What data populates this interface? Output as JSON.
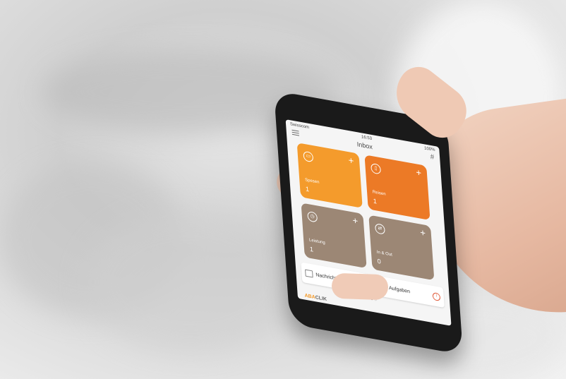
{
  "status": {
    "carrier": "Swisscom",
    "time": "16:53",
    "battery": "100%"
  },
  "nav": {
    "title": "Inbox",
    "menu_icon": "hamburger-icon",
    "grid_icon": "grid-icon"
  },
  "tiles": [
    {
      "label": "Spesen",
      "count": "1",
      "color": "#f49b2c",
      "icon": "receipt-icon"
    },
    {
      "label": "Reisen",
      "count": "1",
      "color": "#ec7a26",
      "icon": "luggage-icon"
    },
    {
      "label": "Leistung",
      "count": "1",
      "color": "#9c8775",
      "icon": "clock-icon"
    },
    {
      "label": "In & Out",
      "count": "0",
      "color": "#9c8775",
      "icon": "in-out-icon"
    }
  ],
  "cards": {
    "messages": {
      "label": "Nachrichten",
      "icon": "message-icon"
    },
    "tasks": {
      "label": "Aufgaben",
      "icon": "clipboard-icon",
      "alert_icon": "alert-icon"
    }
  },
  "brand": {
    "part1": "ABA",
    "part2": "CLIK"
  }
}
